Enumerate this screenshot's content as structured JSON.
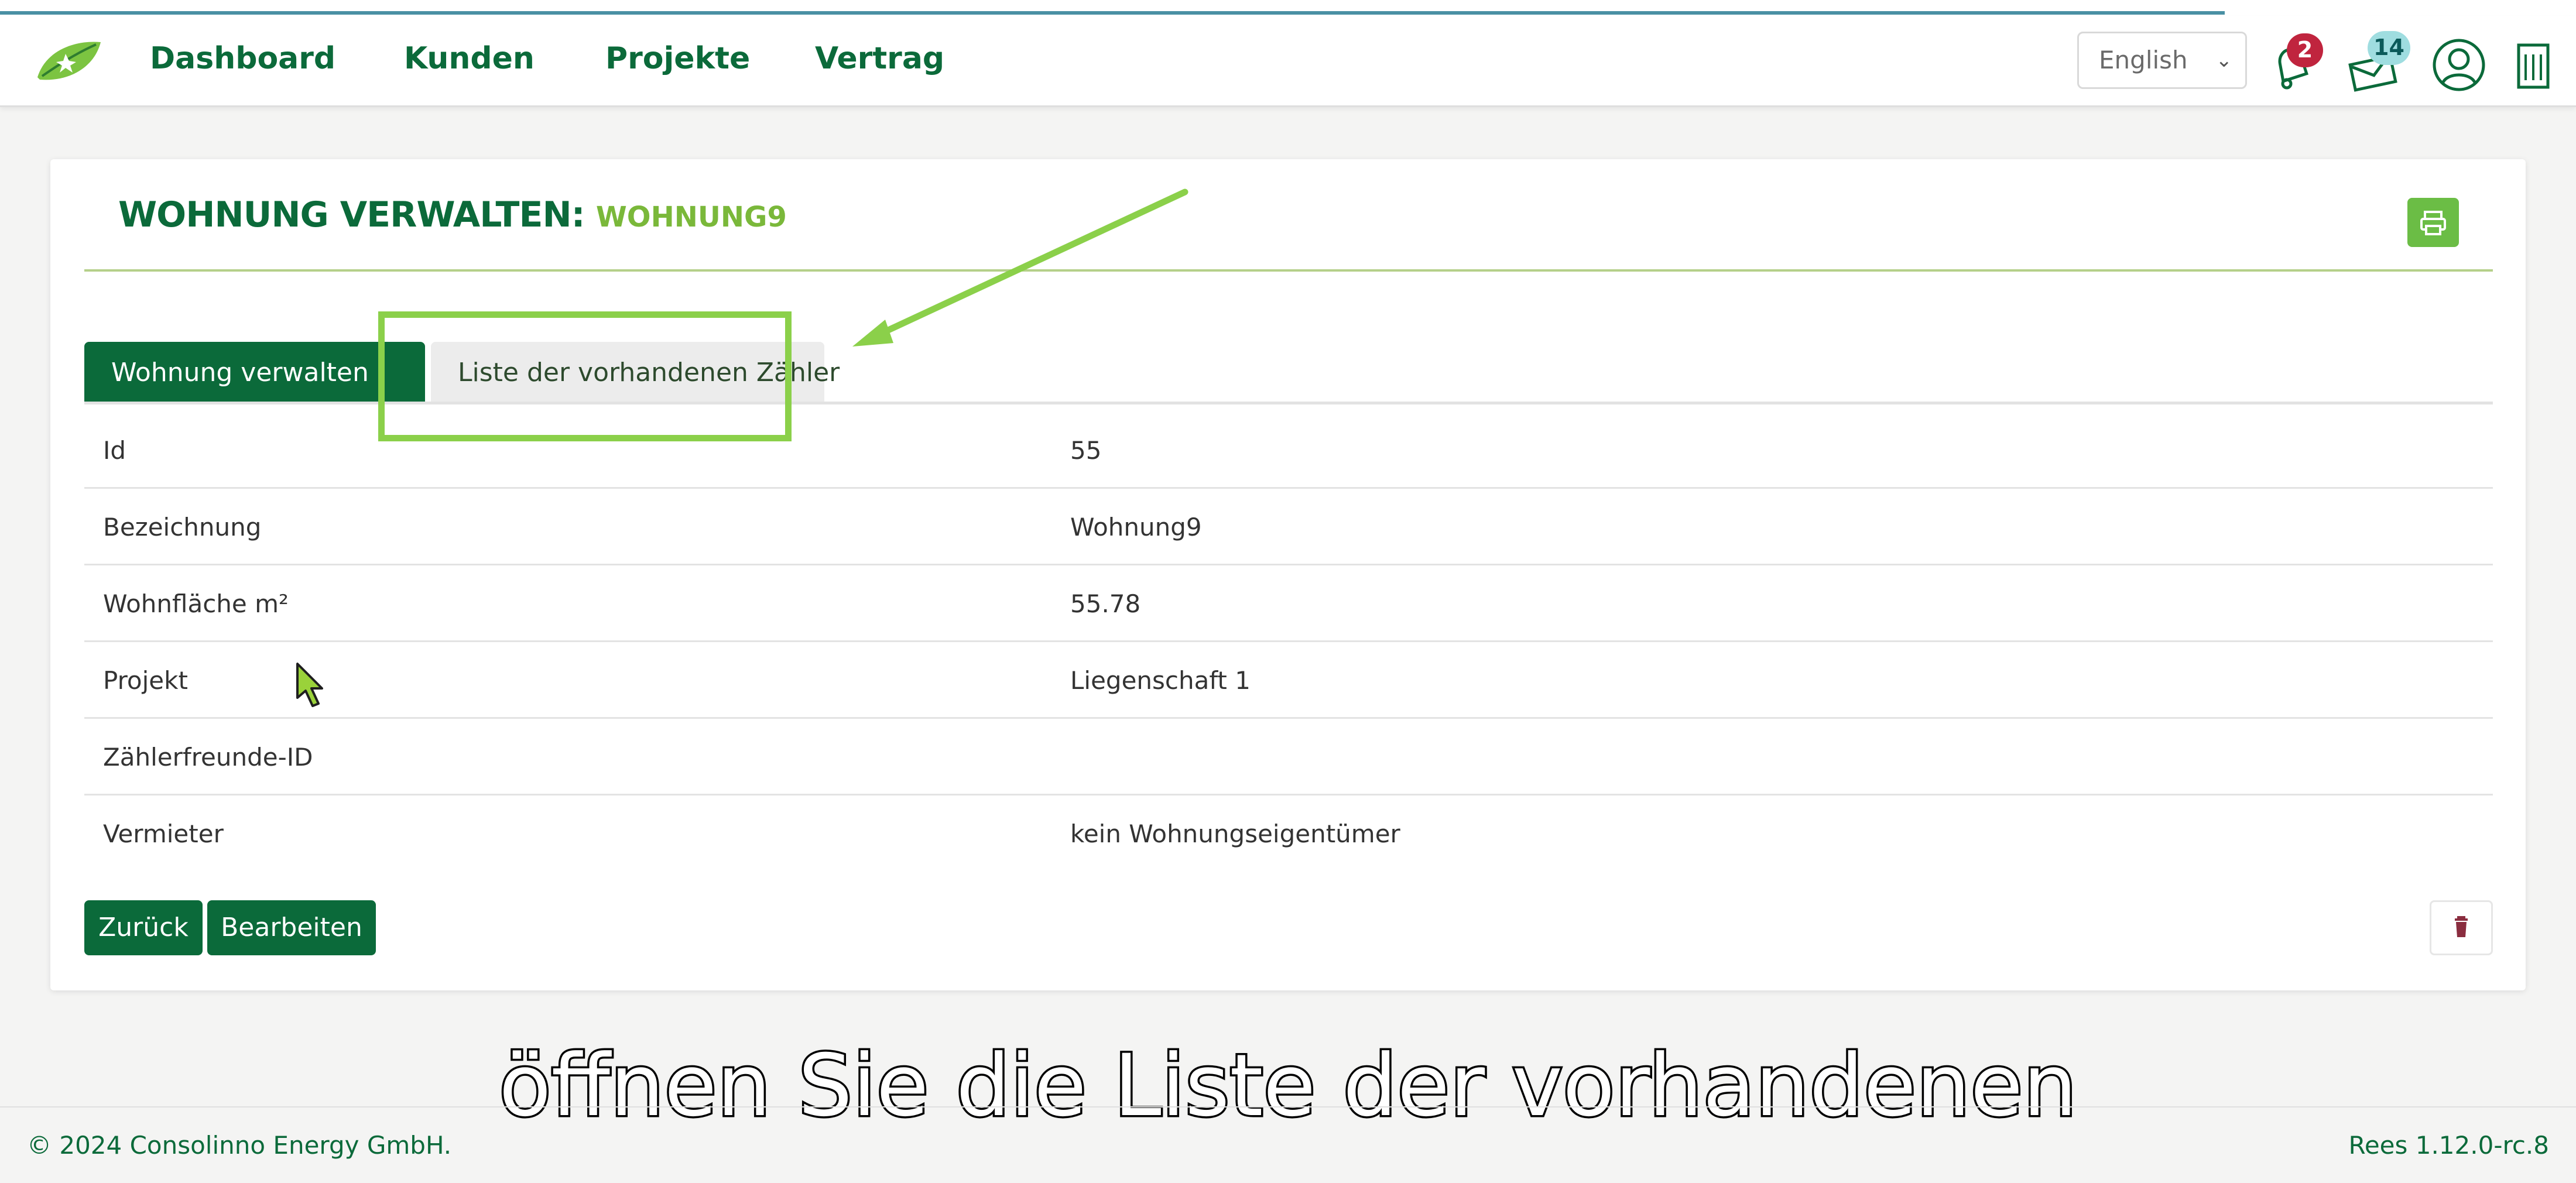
{
  "navbar": {
    "links": [
      "Dashboard",
      "Kunden",
      "Projekte",
      "Vertrag"
    ],
    "language": "English",
    "notifications_count": "2",
    "messages_count": "14"
  },
  "page": {
    "title_prefix": "WOHNUNG VERWALTEN:",
    "title_name": "WOHNUNG9"
  },
  "tabs": [
    {
      "label": "Wohnung verwalten",
      "active": true
    },
    {
      "label": "Liste der vorhandenen Zähler",
      "active": false
    }
  ],
  "details": [
    {
      "key": "Id",
      "value": "55"
    },
    {
      "key": "Bezeichnung",
      "value": "Wohnung9"
    },
    {
      "key": "Wohnfläche m²",
      "value": "55.78"
    },
    {
      "key": "Projekt",
      "value": "Liegenschaft 1"
    },
    {
      "key": "Zählerfreunde-ID",
      "value": ""
    },
    {
      "key": "Vermieter",
      "value": "kein Wohnungseigentümer"
    }
  ],
  "actions": {
    "back_label": "Zurück",
    "edit_label": "Bearbeiten"
  },
  "caption": "öffnen Sie die Liste der vorhandenen",
  "footer": {
    "copyright": "© 2024 Consolinno Energy GmbH.",
    "version": "Rees 1.12.0-rc.8"
  },
  "colors": {
    "primary": "#0b6a3a",
    "accent": "#6bbd45",
    "highlight": "#8bd04a",
    "badge_red": "#c0243e",
    "badge_teal": "#9fdde0"
  },
  "icons": [
    "leaf-logo",
    "bell-icon",
    "envelope-icon",
    "user-circle-icon",
    "building-icon",
    "printer-icon",
    "trash-icon",
    "mouse-cursor-icon"
  ]
}
